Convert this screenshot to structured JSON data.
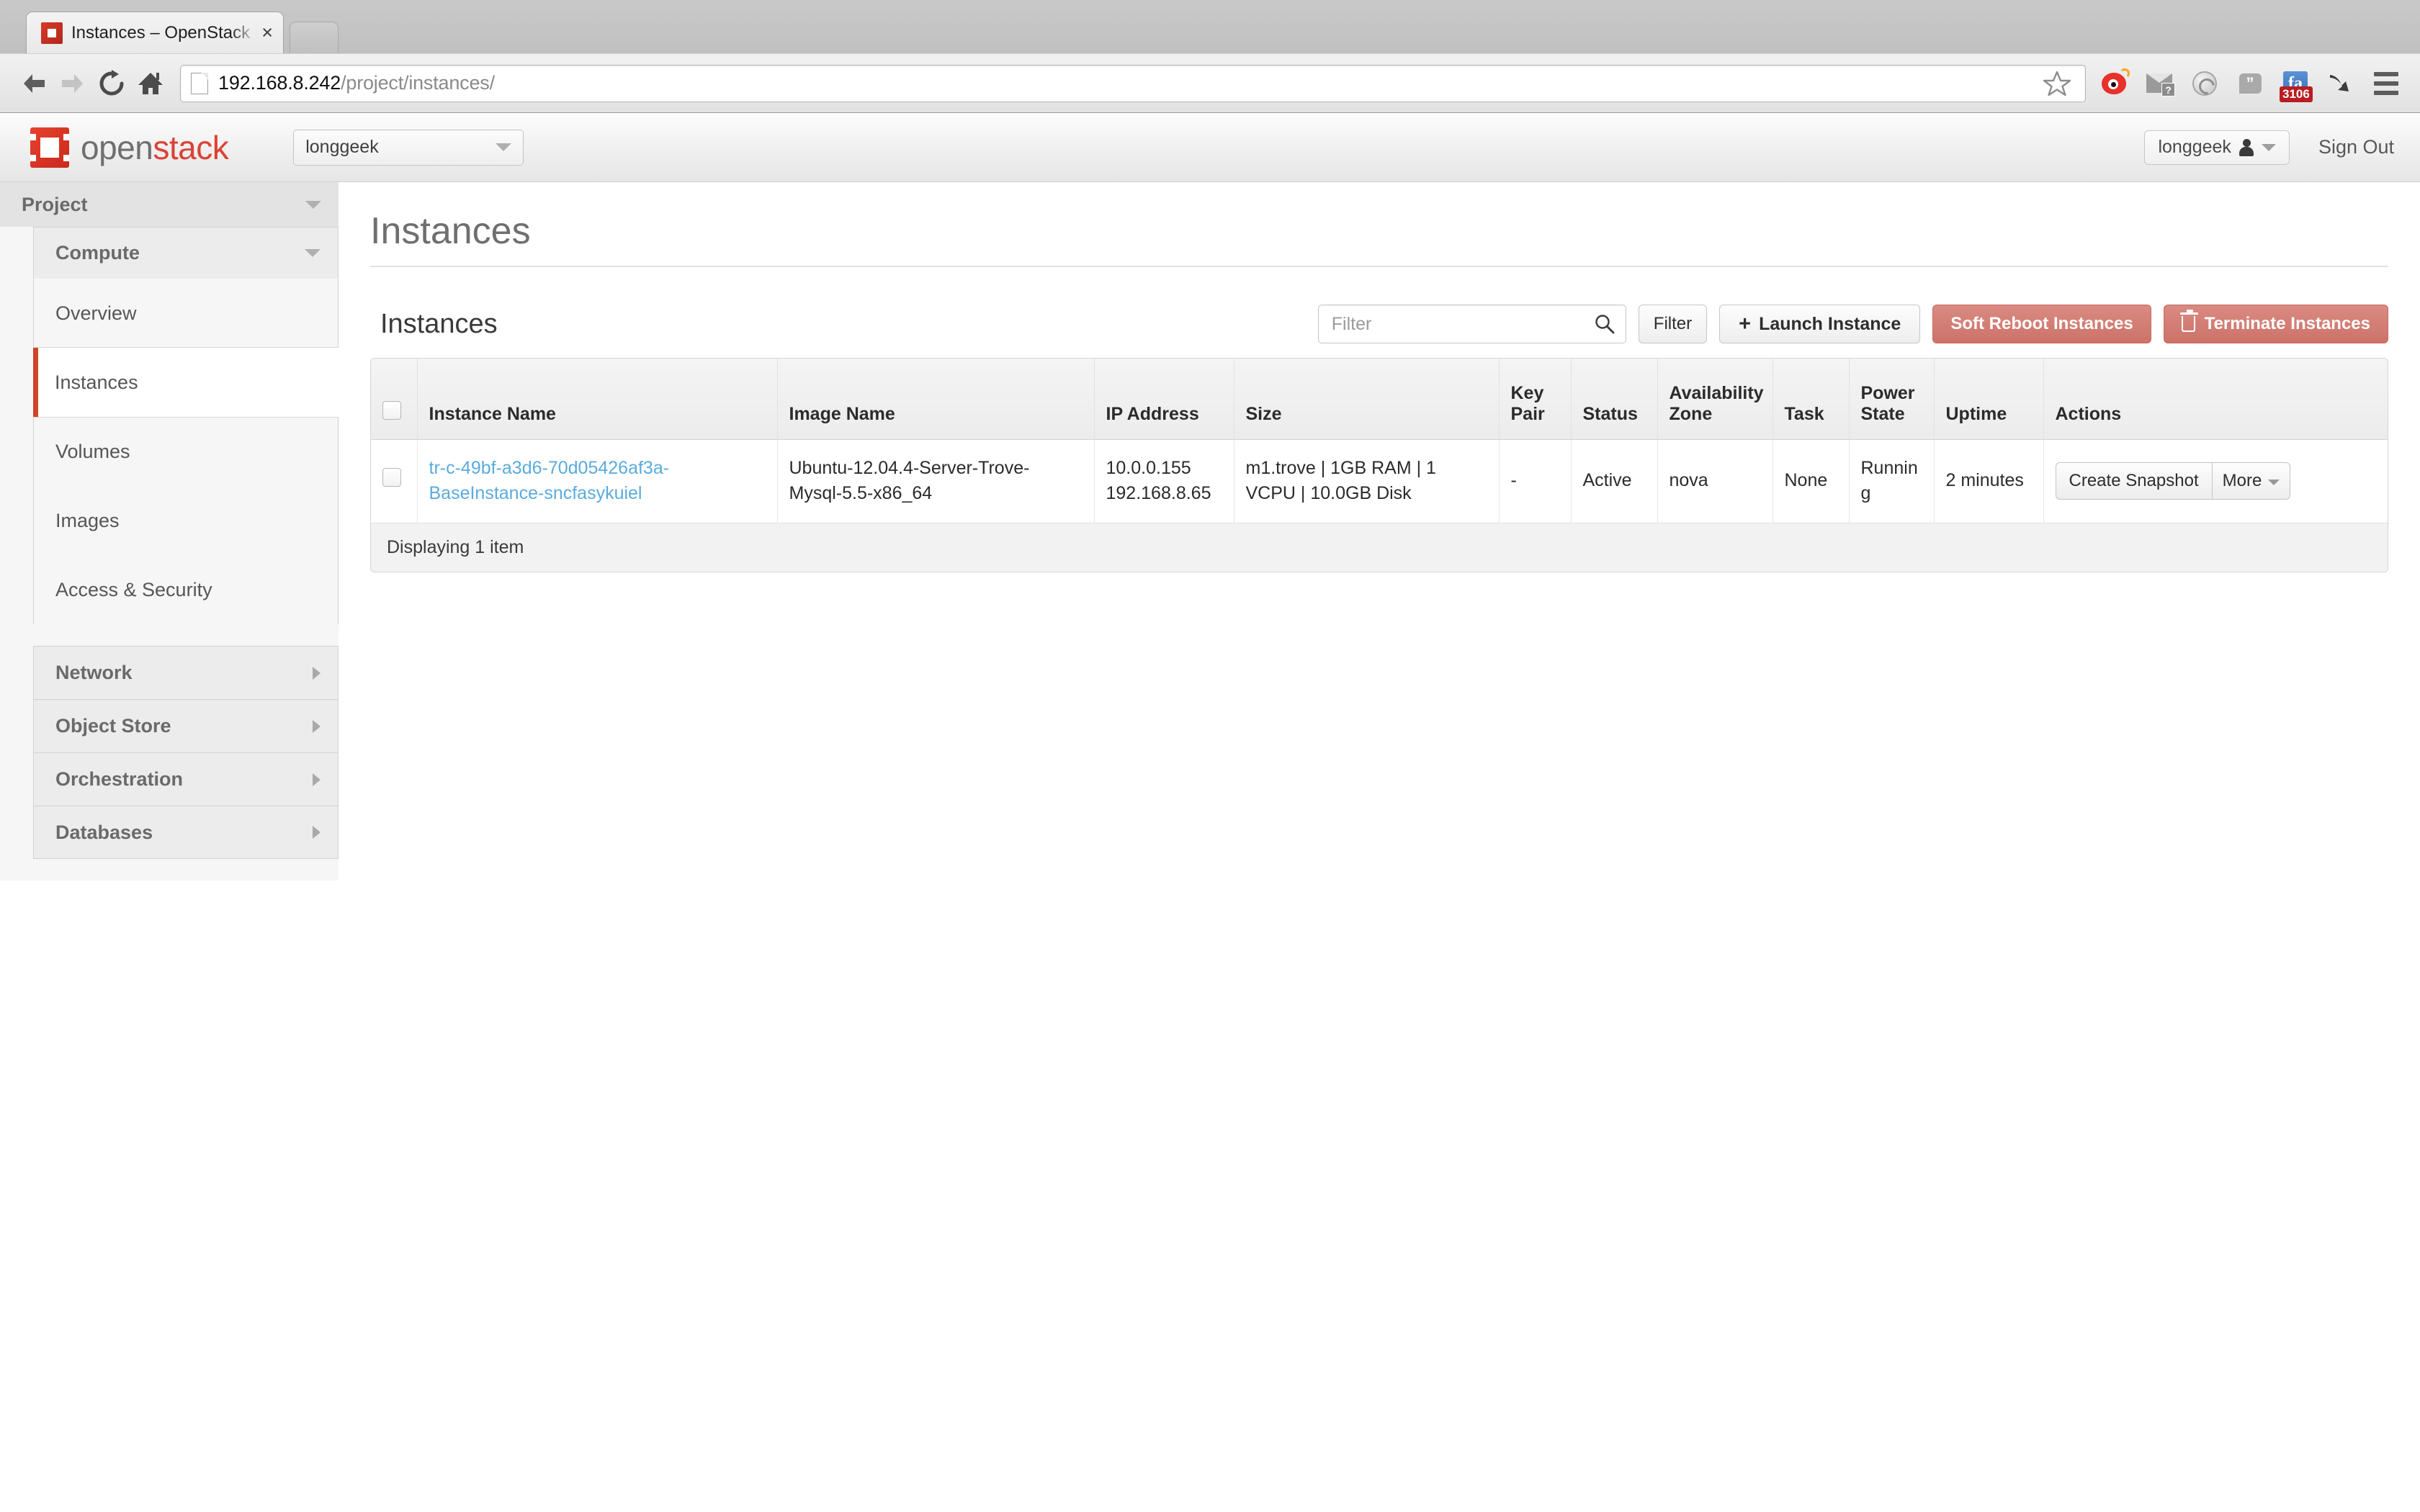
{
  "browser": {
    "tab": {
      "title": "Instances – OpenStack Das",
      "favicon_name": "openstack-favicon",
      "close_label": "×"
    },
    "new_tab_label": "",
    "nav": {
      "back": "back-arrow",
      "forward": "forward-arrow",
      "reload": "reload",
      "home": "home"
    },
    "url": {
      "host": "192.168.8.242",
      "path": "/project/instances/"
    },
    "extensions": [
      {
        "name": "weibo-icon"
      },
      {
        "name": "gmail-icon",
        "badge": "?"
      },
      {
        "name": "globe-sync-icon"
      },
      {
        "name": "hangouts-icon",
        "glyph": "”"
      },
      {
        "name": "facebook-icon",
        "glyph": "fa",
        "badge": "3106"
      },
      {
        "name": "download-arrow-icon"
      },
      {
        "name": "chrome-menu-icon"
      }
    ]
  },
  "header": {
    "logo_open": "open",
    "logo_stack": "stack",
    "project_select": "longgeek",
    "user_menu": "longgeek",
    "sign_out": "Sign Out"
  },
  "sidebar": {
    "project_label": "Project",
    "compute_label": "Compute",
    "compute_items": [
      {
        "label": "Overview",
        "active": false
      },
      {
        "label": "Instances",
        "active": true
      },
      {
        "label": "Volumes",
        "active": false
      },
      {
        "label": "Images",
        "active": false
      },
      {
        "label": "Access & Security",
        "active": false
      }
    ],
    "collapsed_groups": [
      {
        "label": "Network"
      },
      {
        "label": "Object Store"
      },
      {
        "label": "Orchestration"
      },
      {
        "label": "Databases"
      }
    ]
  },
  "main": {
    "page_title": "Instances",
    "table_title": "Instances",
    "filter_placeholder": "Filter",
    "filter_value": "",
    "buttons": {
      "filter": "Filter",
      "launch_instance": "Launch Instance",
      "soft_reboot": "Soft Reboot Instances",
      "terminate": "Terminate Instances"
    },
    "columns": [
      "Instance Name",
      "Image Name",
      "IP Address",
      "Size",
      "Key Pair",
      "Status",
      "Availability Zone",
      "Task",
      "Power State",
      "Uptime",
      "Actions"
    ],
    "rows": [
      {
        "instance_name": "tr-c-49bf-a3d6-70d05426af3a-BaseInstance-sncfasykuiel",
        "image_name": "Ubuntu-12.04.4-Server-Trove-Mysql-5.5-x86_64",
        "ip_address": "10.0.0.155 192.168.8.65",
        "size": "m1.trove | 1GB RAM | 1 VCPU | 10.0GB Disk",
        "key_pair": "-",
        "status": "Active",
        "availability_zone": "nova",
        "task": "None",
        "power_state": "Running",
        "uptime": "2 minutes",
        "action_primary": "Create Snapshot",
        "action_more": "More"
      }
    ],
    "footer": "Displaying 1 item"
  },
  "colors": {
    "accent_red": "#cf4527",
    "link_blue": "#5babdd",
    "danger": "#cd7269",
    "brand_red": "#da4335"
  }
}
